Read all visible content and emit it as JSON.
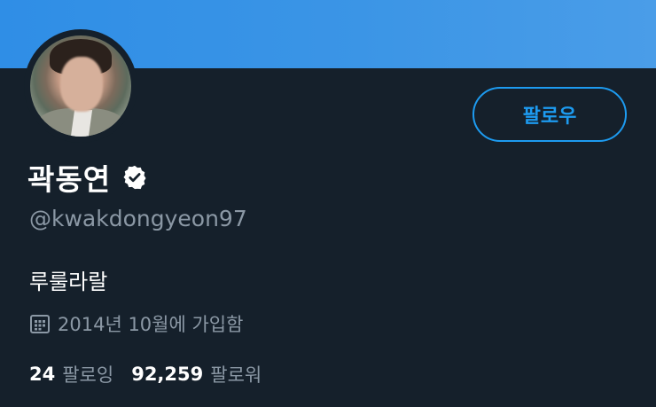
{
  "profile": {
    "display_name": "곽동연",
    "handle": "@kwakdongyeon97",
    "bio": "루룰라랄",
    "joined": "2014년 10월에 가입함",
    "verified": true
  },
  "actions": {
    "follow_label": "팔로우"
  },
  "stats": {
    "following_count": "24",
    "following_label": "팔로잉",
    "followers_count": "92,259",
    "followers_label": "팔로워"
  },
  "icons": {
    "verified": "verified-badge-icon",
    "joined": "calendar-icon"
  },
  "colors": {
    "background": "#15202b",
    "banner": "#3b95e6",
    "accent": "#1d9bf0",
    "secondary_text": "#8b98a5"
  }
}
